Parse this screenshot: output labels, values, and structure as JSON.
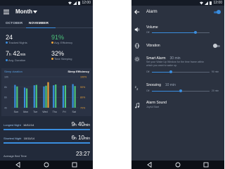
{
  "status": {
    "time": "12:00"
  },
  "stats": {
    "title": "Month",
    "tabs": [
      {
        "label": "OCTOBER"
      },
      {
        "label": "NOVEMBER"
      }
    ],
    "tracked_nights": {
      "value": "24",
      "label": "Tracked Nights"
    },
    "avg_efficiency": {
      "value": "91%",
      "label": "Avg. Efficiency"
    },
    "avg_duration": {
      "hours": "7",
      "h_unit": "h",
      "minutes": "42",
      "m_unit": "min",
      "label": "Avg. Duration"
    },
    "time_sleeping": {
      "value": "32%",
      "label": "Time Sleeping"
    },
    "chart": {
      "left_label": "Sleep duration",
      "right_label": "Sleep Efficiency"
    },
    "longest": {
      "label": "Longest Night",
      "date": "16/11/14",
      "hours": "9",
      "h_unit": "h",
      "minutes": "40",
      "m_unit": "min"
    },
    "shortest": {
      "label": "Shortest Night",
      "date": "10/11/14",
      "hours": "6",
      "h_unit": "h",
      "minutes": "10",
      "m_unit": "min"
    },
    "avg_bed_time": {
      "label": "Average Bed Time",
      "value": "23:27"
    }
  },
  "chart_data": {
    "type": "bar",
    "categories": [
      "Sun",
      "Mon",
      "Tue",
      "Wed",
      "Thu",
      "Fri",
      "Sat"
    ],
    "y_ticks_left": [
      "10h",
      "8h",
      "6h",
      "4h"
    ],
    "y_ticks_right": [
      "100%",
      "90%",
      "80%",
      "70%"
    ],
    "ylim_left": [
      2,
      10
    ],
    "series": [
      {
        "name": "Sleep duration",
        "color": "#3a8dde",
        "values": [
          7.9,
          7.2,
          7.8,
          7.5,
          7.8,
          7.7,
          8.1
        ]
      },
      {
        "name": "Sleep Efficiency",
        "color": "#4cc47a",
        "values": [
          7.5,
          7.0,
          7.9,
          7.7,
          8.0,
          7.8,
          7.6
        ]
      }
    ],
    "extra_bars": [
      {
        "category": "Wed",
        "color": "#e9a23b",
        "value": 8.6
      }
    ]
  },
  "alarm": {
    "title": "Alarm",
    "enabled": true,
    "volume": {
      "title": "Volume",
      "off": "Off",
      "level": 0.75
    },
    "vibration": {
      "title": "Vibration",
      "enabled": false
    },
    "smart_alarm": {
      "title": "Smart Alarm",
      "value": "30 min",
      "subtitle1": "Set your Wake Up Window for the time frame within",
      "subtitle2": "which you want to wake up.",
      "off": "Off",
      "max": "90 min",
      "level": 0.33
    },
    "snoozing": {
      "title": "Snoozing",
      "value": "10 min",
      "off": "Off",
      "max": "20 min",
      "level": 0.5
    },
    "sound": {
      "title": "Alarm Sound",
      "value": "Joyful Start"
    }
  },
  "colors": {
    "accent": "#3a8dde",
    "green": "#4cc47a",
    "orange": "#e9a23b"
  },
  "icons": [
    "menu-icon",
    "dropdown-arrow-icon",
    "back-arrow-icon",
    "volume-icon",
    "vibration-icon",
    "smart-alarm-icon",
    "snooze-icon",
    "music-note-icon",
    "nav-back-icon",
    "nav-home-icon",
    "nav-recent-icon"
  ]
}
